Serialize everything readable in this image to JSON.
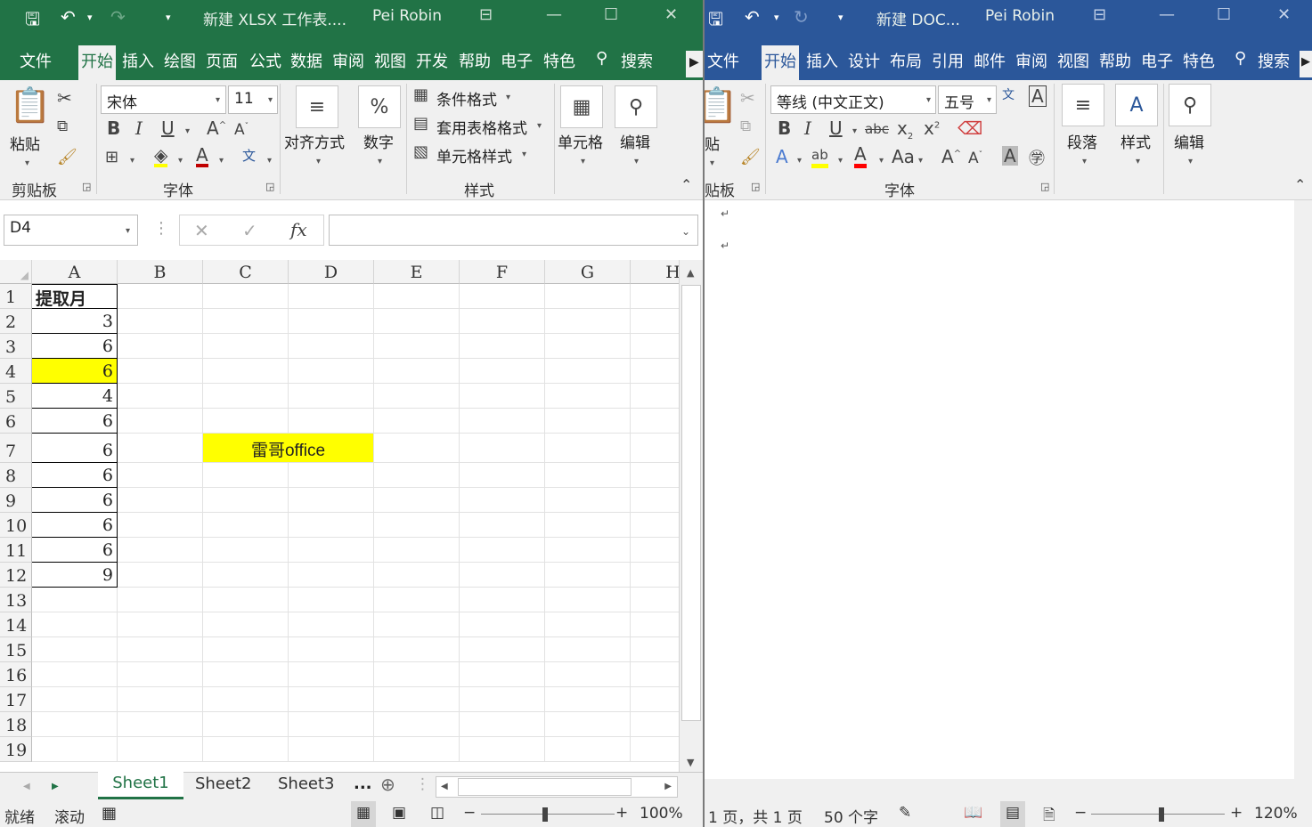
{
  "excel": {
    "title": "新建 XLSX 工作表....",
    "user": "Pei Robin",
    "tabs": [
      "文件",
      "开始",
      "插入",
      "绘图",
      "页面",
      "公式",
      "数据",
      "审阅",
      "视图",
      "开发",
      "帮助",
      "电子",
      "特色"
    ],
    "search": "搜索",
    "paste": "粘贴",
    "group_clipboard": "剪贴板",
    "font_name": "宋体",
    "font_size": "11",
    "group_font": "字体",
    "align": "对齐方式",
    "number": "数字",
    "cond_format": "条件格式",
    "table_format": "套用表格格式",
    "cell_style": "单元格样式",
    "group_styles": "样式",
    "cells": "单元格",
    "edit": "编辑",
    "name_box": "D4",
    "fx": "fx",
    "columns": [
      "A",
      "B",
      "C",
      "D",
      "E",
      "F",
      "G",
      "H"
    ],
    "rows": [
      "1",
      "2",
      "3",
      "4",
      "5",
      "6",
      "7",
      "8",
      "9",
      "10",
      "11",
      "12",
      "13",
      "14",
      "15",
      "16",
      "17",
      "18",
      "19"
    ],
    "a_values": [
      "提取月",
      "3",
      "6",
      "6",
      "4",
      "6",
      "6",
      "6",
      "6",
      "6",
      "6",
      "9"
    ],
    "c7_text": "雷哥office",
    "highlight_color": "#ffff00",
    "sheets": [
      "Sheet1",
      "Sheet2",
      "Sheet3"
    ],
    "more_sheets": "...",
    "status_ready": "就绪",
    "status_scroll": "滚动",
    "zoom": "100%"
  },
  "word": {
    "title": "新建 DOC...",
    "user": "Pei Robin",
    "tabs": [
      "文件",
      "开始",
      "插入",
      "设计",
      "布局",
      "引用",
      "邮件",
      "审阅",
      "视图",
      "帮助",
      "电子",
      "特色"
    ],
    "search": "搜索",
    "paste": "贴",
    "group_clipboard": "贴板",
    "font_name": "等线 (中文正文)",
    "font_size": "五号",
    "group_font": "字体",
    "paragraph": "段落",
    "styles": "样式",
    "edit": "编辑",
    "paragraph_marks": [
      "↵",
      "↵"
    ],
    "status_pages": "1 页，共 1 页",
    "status_words": "50 个字",
    "zoom": "120%"
  }
}
